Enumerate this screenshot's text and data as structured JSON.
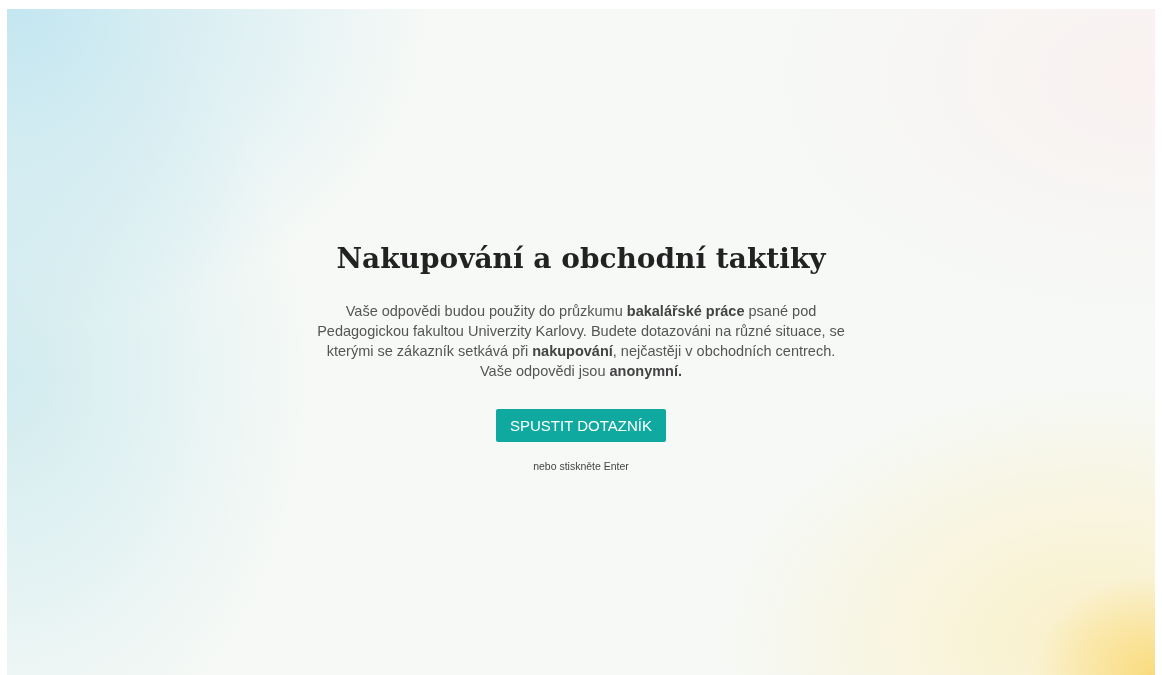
{
  "title": "Nakupování a obchodní taktiky",
  "intro": "Vaše odpovědi budou použity do průzkumu **bakalářské práce** psané pod Pedagogickou fakultou Univerzity Karlovy. Budete dotazováni na různé situace, se kterými se zákazník setkává při **nakupování**, nejčastěji v obchodních centrech. Vaše odpovědi jsou **anonymní.**",
  "start_button": "SPUSTIT DOTAZNÍK",
  "hint": "nebo stiskněte Enter"
}
